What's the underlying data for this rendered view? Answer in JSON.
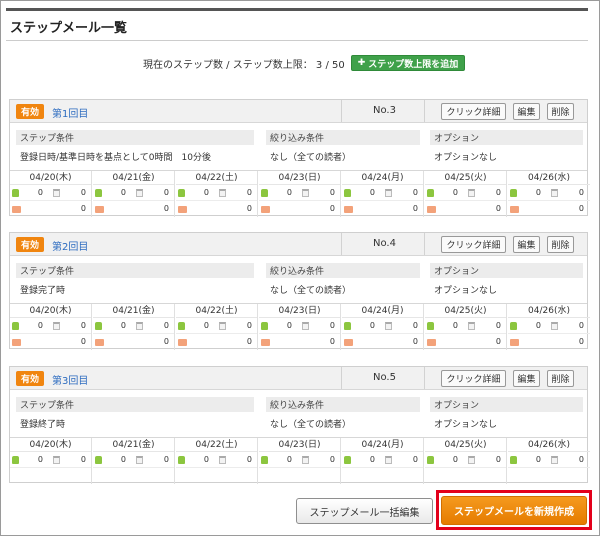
{
  "page": {
    "title": "ステップメール一覧",
    "summary_text": "現在のステップ数 / ステップ数上限： 3 / 50",
    "add_limit_button": "ステップ数上限を追加"
  },
  "header_buttons": {
    "click_detail": "クリック詳細",
    "edit": "編集",
    "delete": "削除"
  },
  "condition_labels": {
    "step": "ステップ条件",
    "filter": "絞り込み条件",
    "option": "オプション"
  },
  "dates": [
    "04/20(木)",
    "04/21(金)",
    "04/22(土)",
    "04/23(日)",
    "04/24(月)",
    "04/25(火)",
    "04/26(水)"
  ],
  "steps": [
    {
      "status": "有効",
      "name": "第1回目",
      "number": "No.3",
      "step_condition": "登録日時/基準日時を基点として0時間　10分後",
      "filter_condition": "なし（全ての読者）",
      "option": "オプションなし",
      "days": [
        {
          "opened": "0",
          "trashed": "0",
          "clicked": "0"
        },
        {
          "opened": "0",
          "trashed": "0",
          "clicked": "0"
        },
        {
          "opened": "0",
          "trashed": "0",
          "clicked": "0"
        },
        {
          "opened": "0",
          "trashed": "0",
          "clicked": "0"
        },
        {
          "opened": "0",
          "trashed": "0",
          "clicked": "0"
        },
        {
          "opened": "0",
          "trashed": "0",
          "clicked": "0"
        },
        {
          "opened": "0",
          "trashed": "0",
          "clicked": "0"
        }
      ]
    },
    {
      "status": "有効",
      "name": "第2回目",
      "number": "No.4",
      "step_condition": "登録完了時",
      "filter_condition": "なし（全ての読者）",
      "option": "オプションなし",
      "days": [
        {
          "opened": "0",
          "trashed": "0",
          "clicked": "0"
        },
        {
          "opened": "0",
          "trashed": "0",
          "clicked": "0"
        },
        {
          "opened": "0",
          "trashed": "0",
          "clicked": "0"
        },
        {
          "opened": "0",
          "trashed": "0",
          "clicked": "0"
        },
        {
          "opened": "0",
          "trashed": "0",
          "clicked": "0"
        },
        {
          "opened": "0",
          "trashed": "0",
          "clicked": "0"
        },
        {
          "opened": "0",
          "trashed": "0",
          "clicked": "0"
        }
      ]
    },
    {
      "status": "有効",
      "name": "第3回目",
      "number": "No.5",
      "step_condition": "登録終了時",
      "filter_condition": "なし（全ての読者）",
      "option": "オプションなし",
      "days": [
        {
          "opened": "0",
          "trashed": "0",
          "clicked": ""
        },
        {
          "opened": "0",
          "trashed": "0",
          "clicked": ""
        },
        {
          "opened": "0",
          "trashed": "0",
          "clicked": ""
        },
        {
          "opened": "0",
          "trashed": "0",
          "clicked": ""
        },
        {
          "opened": "0",
          "trashed": "0",
          "clicked": ""
        },
        {
          "opened": "0",
          "trashed": "0",
          "clicked": ""
        },
        {
          "opened": "0",
          "trashed": "0",
          "clicked": ""
        }
      ]
    }
  ],
  "footer": {
    "bulk_edit_button": "ステップメール一括編集",
    "new_button": "ステップメールを新規作成"
  }
}
